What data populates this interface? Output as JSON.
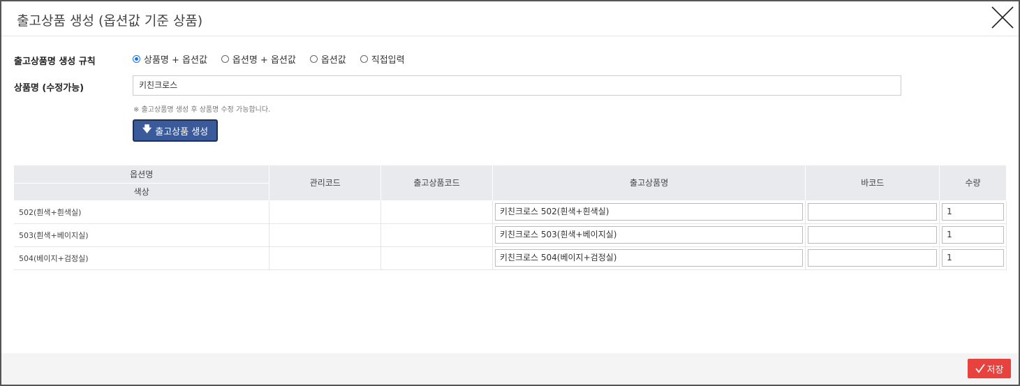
{
  "modal": {
    "title": "출고상품 생성 (옵션값 기준 상품)"
  },
  "rule": {
    "label": "출고상품명 생성 규칙",
    "options": [
      {
        "label": "상품명 + 옵션값",
        "checked": true
      },
      {
        "label": "옵션명 + 옵션값",
        "checked": false
      },
      {
        "label": "옵션값",
        "checked": false
      },
      {
        "label": "직접입력",
        "checked": false
      }
    ]
  },
  "product_name": {
    "label": "상품명 (수정가능)",
    "value": "키친크로스",
    "hint": "※ 출고상품명 생성 후 상품명 수정 가능합니다."
  },
  "generate_button": {
    "label": "출고상품 생성"
  },
  "table": {
    "headers": {
      "option_name": "옵션명",
      "option_sub": "색상",
      "mgmt_code": "관리코드",
      "out_code": "출고상품코드",
      "out_name": "출고상품명",
      "barcode": "바코드",
      "qty": "수량"
    },
    "rows": [
      {
        "option": "502(흰색+흰색실)",
        "mgmt_code": "",
        "out_code": "",
        "out_name": "키친크로스 502(흰색+흰색실)",
        "barcode": "",
        "qty": "1"
      },
      {
        "option": "503(흰색+베이지실)",
        "mgmt_code": "",
        "out_code": "",
        "out_name": "키친크로스 503(흰색+베이지실)",
        "barcode": "",
        "qty": "1"
      },
      {
        "option": "504(베이지+검정실)",
        "mgmt_code": "",
        "out_code": "",
        "out_name": "키친크로스 504(베이지+검정실)",
        "barcode": "",
        "qty": "1"
      }
    ]
  },
  "footer": {
    "save_label": "저장"
  },
  "colors": {
    "generate_button_bg": "#3a5a9b",
    "save_button_bg": "#e8423f",
    "radio_accent": "#1a73e8"
  }
}
